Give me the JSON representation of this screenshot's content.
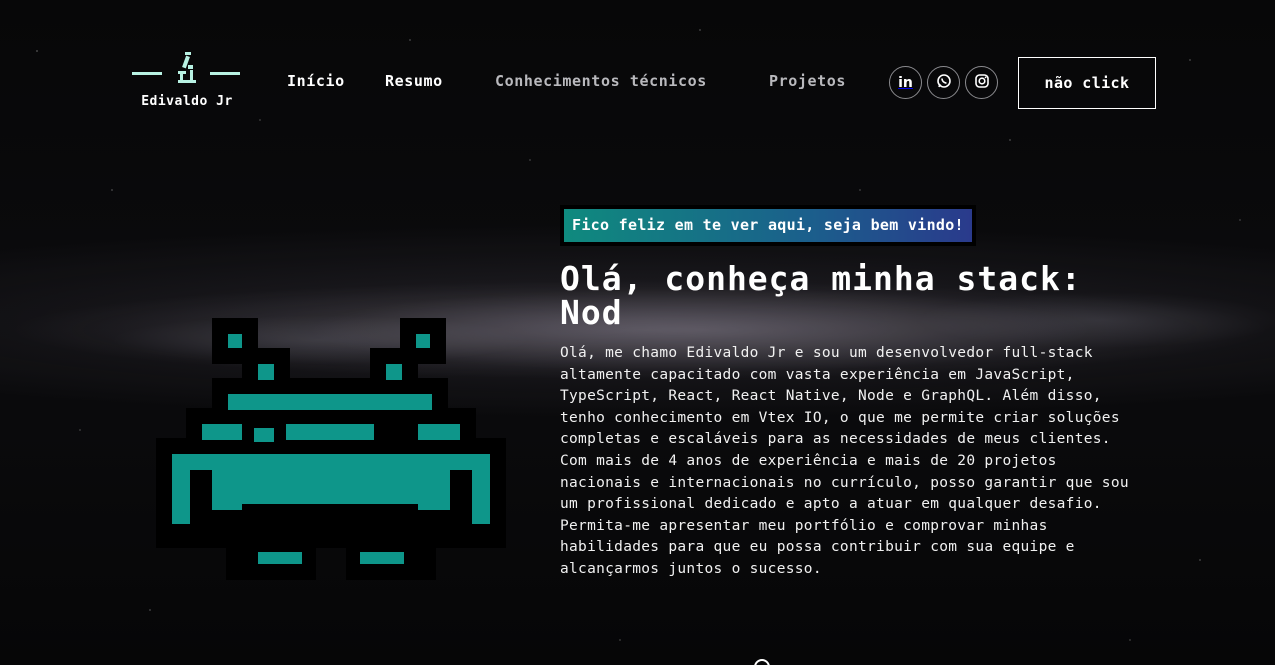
{
  "logo": {
    "name": "Edivaldo Jr",
    "icon": "microscope-icon"
  },
  "nav": {
    "items": [
      {
        "label": "Início"
      },
      {
        "label": "Resumo"
      },
      {
        "label": "Conhecimentos técnicos"
      },
      {
        "label": "Projetos"
      }
    ]
  },
  "social": [
    {
      "icon": "linkedin-icon",
      "label": "in"
    },
    {
      "icon": "whatsapp-icon"
    },
    {
      "icon": "instagram-icon"
    }
  ],
  "cta": {
    "label": "não click"
  },
  "hero": {
    "tagline": "Fico feliz em te ver aqui, seja bem vindo!",
    "headline": "Olá, conheça minha stack: Nod",
    "intro": "Olá, me chamo Edivaldo Jr e sou um desenvolvedor full-stack altamente capacitado com vasta experiência em JavaScript, TypeScript, React, React Native, Node e GraphQL. Além disso, tenho conhecimento em Vtex IO, o que me permite criar soluções completas e escaláveis para as necessidades de meus clientes. Com mais de 4 anos de experiência e mais de 20 projetos nacionais e internacionais no currículo, posso garantir que sou um profissional dedicado e apto a atuar em qualquer desafio. Permita-me apresentar meu portfólio e comprovar minhas habilidades para que eu possa contribuir com sua equipe e alcançarmos juntos o sucesso.",
    "illustration": "space-invader-icon"
  },
  "colors": {
    "accent": "#0e968a",
    "logo": "#b8f2e3",
    "tagline_gradient_start": "#0f8a7e",
    "tagline_gradient_end": "#2a3a8c"
  }
}
